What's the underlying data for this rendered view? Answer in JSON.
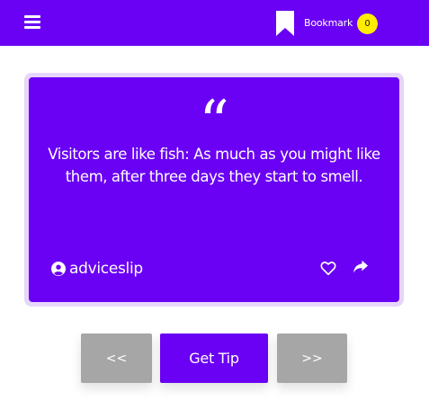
{
  "header": {
    "bookmark_label": "Bookmark",
    "bookmark_count": "0",
    "menu_icon": "hamburger-menu-icon",
    "bookmark_icon": "bookmark-icon"
  },
  "card": {
    "quote_mark": "“",
    "quote": "Visitors are like fish: As much as you might like them, after three days they start to smell.",
    "author": "adviceslip",
    "author_icon": "user-circle-icon",
    "like_icon": "heart-outline-icon",
    "share_icon": "share-arrow-icon"
  },
  "controls": {
    "prev_label": "<<",
    "tip_label": "Get Tip",
    "next_label": ">>"
  },
  "colors": {
    "primary": "#6a00f4",
    "badge": "#ffec00",
    "nav_gray": "#a6a6a6",
    "card_border": "#e6d6fb"
  }
}
